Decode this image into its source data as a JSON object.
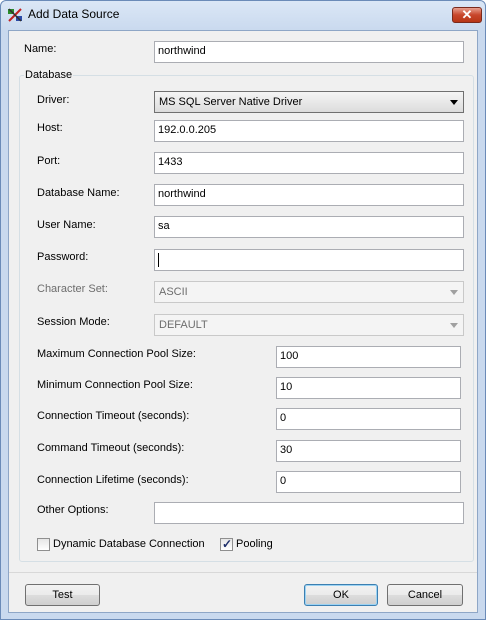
{
  "window": {
    "title": "Add Data Source"
  },
  "fields": {
    "name": {
      "label": "Name:",
      "value": "northwind"
    },
    "database_group_label": "Database",
    "driver": {
      "label": "Driver:",
      "value": "MS SQL Server Native Driver"
    },
    "host": {
      "label": "Host:",
      "value": "192.0.0.205"
    },
    "port": {
      "label": "Port:",
      "value": "1433"
    },
    "database_name": {
      "label": "Database Name:",
      "value": "northwind"
    },
    "user_name": {
      "label": "User Name:",
      "value": "sa"
    },
    "password": {
      "label": "Password:",
      "value": ""
    },
    "character_set": {
      "label": "Character Set:",
      "value": "ASCII"
    },
    "session_mode": {
      "label": "Session Mode:",
      "value": "DEFAULT"
    },
    "max_pool": {
      "label": "Maximum Connection Pool Size:",
      "value": "100"
    },
    "min_pool": {
      "label": "Minimum Connection Pool Size:",
      "value": "10"
    },
    "conn_timeout": {
      "label": "Connection Timeout (seconds):",
      "value": "0"
    },
    "cmd_timeout": {
      "label": "Command Timeout (seconds):",
      "value": "30"
    },
    "conn_lifetime": {
      "label": "Connection Lifetime (seconds):",
      "value": "0"
    },
    "other_options": {
      "label": "Other Options:",
      "value": ""
    }
  },
  "checkboxes": {
    "dynamic": {
      "label": "Dynamic Database Connection",
      "checked": false
    },
    "pooling": {
      "label": "Pooling",
      "checked": true
    }
  },
  "buttons": {
    "test": "Test",
    "ok": "OK",
    "cancel": "Cancel"
  },
  "icons": {
    "app": "data-source-icon",
    "close": "close-icon"
  }
}
